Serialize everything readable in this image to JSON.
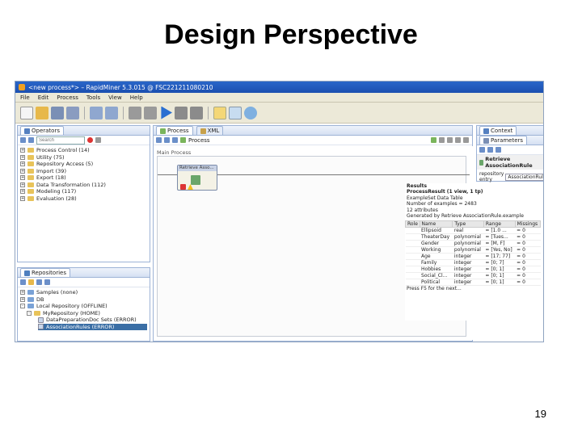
{
  "slide": {
    "title": "Design Perspective",
    "page_number": "19"
  },
  "window": {
    "title": "<new process*> – RapidMiner 5.3.015 @ FSC221211080210",
    "menu": [
      "File",
      "Edit",
      "Process",
      "Tools",
      "View",
      "Help"
    ]
  },
  "operators_panel": {
    "tab_label": "Operators",
    "search_placeholder": "Search",
    "tree": [
      {
        "label": "Process Control (14)"
      },
      {
        "label": "Utility (75)"
      },
      {
        "label": "Repository Access (5)"
      },
      {
        "label": "Import (39)"
      },
      {
        "label": "Export (18)"
      },
      {
        "label": "Data Transformation (112)"
      },
      {
        "label": "Modeling (117)"
      },
      {
        "label": "Evaluation (28)"
      }
    ]
  },
  "repositories_panel": {
    "tab_label": "Repositories",
    "tree": [
      {
        "label": "Samples (none)"
      },
      {
        "label": "DB"
      },
      {
        "label": "Local Repository (OFFLINE)"
      },
      {
        "label": "MyRepository (HOME)"
      },
      {
        "label": "DataPreparationDoc Sets (ERROR)"
      },
      {
        "label": "AssociationRules (ERROR)"
      }
    ]
  },
  "process_panel": {
    "tabs": [
      "Process",
      "XML"
    ],
    "breadcrumb": "Process",
    "main_label": "Main Process",
    "operator_label": "Retrieve Asso..."
  },
  "right_panel": {
    "tabs": [
      "Context",
      "Parameters"
    ],
    "operator_title": "Retrieve AssociationRule",
    "param_label": "repository entry",
    "param_value": "AssociationRule"
  },
  "results": {
    "lines": [
      "Results",
      "ProcessResult (1 view, 1 tp)",
      "ExampleSet Data Table",
      "Number of examples = 2483",
      "12 attributes",
      "Generated by Retrieve AssociationRule.example"
    ],
    "columns": [
      "Role",
      "Name",
      "Type",
      "Range",
      "Missings"
    ],
    "rows": [
      [
        "",
        "Ellipsoid",
        "real",
        "= [1.0 ...",
        "= 0"
      ],
      [
        "",
        "TheaterDay",
        "polynomial",
        "= [Tues...",
        "= 0"
      ],
      [
        "",
        "Gender",
        "polynomial",
        "= [M, F]",
        "= 0"
      ],
      [
        "",
        "Working",
        "polynomial",
        "= [Yes, No]",
        "= 0"
      ],
      [
        "",
        "Age",
        "integer",
        "= [17; 77]",
        "= 0"
      ],
      [
        "",
        "Family",
        "integer",
        "= [0; 7]",
        "= 0"
      ],
      [
        "",
        "Hobbies",
        "integer",
        "= [0; 1]",
        "= 0"
      ],
      [
        "",
        "Social_Cl...",
        "integer",
        "= [0; 1]",
        "= 0"
      ],
      [
        "",
        "Political",
        "integer",
        "= [0; 1]",
        "= 0"
      ]
    ],
    "footer": "Press F5 for the next..."
  }
}
